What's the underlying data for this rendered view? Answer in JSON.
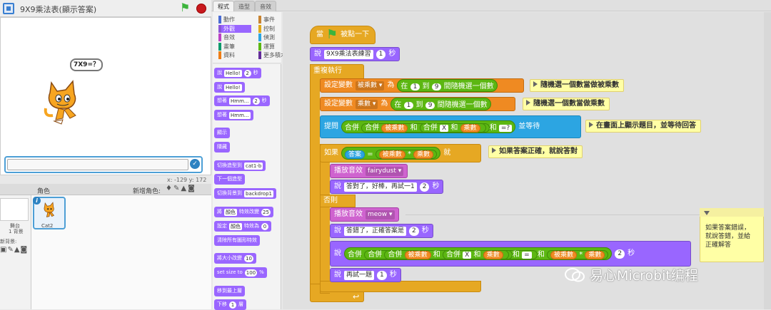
{
  "window": {
    "title": "9X9乘法表(顯示答案)",
    "app_icon_label": "v456"
  },
  "stage": {
    "bubble": "7X9=？",
    "coords": "x: -129  y: 172"
  },
  "sprites": {
    "header_label": "角色",
    "new_sprite_label": "新增角色:",
    "stage_name": "舞台",
    "stage_count": "1 背景",
    "new_backdrop_label": "新背景:",
    "sprite_name": "Cat2"
  },
  "tabs": [
    "程式",
    "造型",
    "音效"
  ],
  "categories": [
    {
      "label": "動作",
      "color": "#4a6cd4"
    },
    {
      "label": "事件",
      "color": "#c88330"
    },
    {
      "label": "外觀",
      "color": "#8a55d7"
    },
    {
      "label": "控制",
      "color": "#e1a91a"
    },
    {
      "label": "音效",
      "color": "#bb42c3"
    },
    {
      "label": "偵測",
      "color": "#2ca5e2"
    },
    {
      "label": "畫筆",
      "color": "#0e9a6c"
    },
    {
      "label": "運算",
      "color": "#5cb712"
    },
    {
      "label": "資料",
      "color": "#ee7d16"
    },
    {
      "label": "更多積木",
      "color": "#632d99"
    }
  ],
  "palette": [
    {
      "text": "說",
      "field": "Hello!",
      "num": "2",
      "suffix": "秒"
    },
    {
      "text": "說",
      "field": "Hello!"
    },
    {
      "text": "想著",
      "field": "Hmm...",
      "num": "2",
      "suffix": "秒"
    },
    {
      "text": "想著",
      "field": "Hmm..."
    },
    {
      "text": "顯示"
    },
    {
      "text": "隱藏"
    },
    {
      "text": "切換造型到",
      "field": "cat1-b"
    },
    {
      "text": "下一個造型"
    },
    {
      "text": "切換背景到",
      "field": "backdrop1"
    },
    {
      "text": "將",
      "field": "顏色",
      "text2": "特效改變",
      "num": "25"
    },
    {
      "text": "設定",
      "field": "顏色",
      "text2": "特效為",
      "num": "0"
    },
    {
      "text": "清除所有圖形特效"
    },
    {
      "text": "將大小改變",
      "num": "10"
    },
    {
      "text": "set size to",
      "num": "100",
      "suffix": "%"
    },
    {
      "text": "移到最上層"
    },
    {
      "text": "下移",
      "num": "1",
      "suffix": "層"
    }
  ],
  "script": {
    "hat": {
      "pre": "當",
      "post": "被點一下"
    },
    "say_title": {
      "label": "說",
      "text": "9X9乘法表練習",
      "secs": "1",
      "unit": "秒"
    },
    "forever": "重複執行",
    "set1": {
      "label": "設定變數",
      "var": "被乘數",
      "to": "為",
      "op_a": "在",
      "from": "1",
      "op_b": "到",
      "to_n": "9",
      "op_c": "間隨機選一個數"
    },
    "set2": {
      "label": "設定變數",
      "var": "乘數",
      "to": "為",
      "op_a": "在",
      "from": "1",
      "op_b": "到",
      "to_n": "9",
      "op_c": "間隨機選一個數"
    },
    "ask": {
      "label": "提問",
      "join": "合併",
      "var1": "被乘數",
      "and": "和",
      "times": "X",
      "var2": "乘數",
      "q": "=?",
      "wait": "並等待"
    },
    "if": {
      "label": "如果",
      "answer": "答案",
      "eq": "=",
      "var1": "被乘數",
      "mul": "*",
      "var2": "乘數",
      "then": "就"
    },
    "play1": {
      "label": "播放音效",
      "sound": "fairydust"
    },
    "say_right": {
      "label": "說",
      "text": "答對了，好棒，再試一1",
      "secs": "2",
      "unit": "秒"
    },
    "else": "否則",
    "play2": {
      "label": "播放音效",
      "sound": "meow"
    },
    "say_wrong": {
      "label": "說",
      "text": "答錯了，正確答案是",
      "secs": "2",
      "unit": "秒"
    },
    "say_join": {
      "label": "說",
      "join": "合併",
      "var1": "被乘數",
      "and": "和",
      "times": "X",
      "var2": "乘數",
      "eq": "=",
      "mul": "*",
      "secs": "2",
      "unit": "秒"
    },
    "say_again": {
      "label": "說",
      "text": "再試一題",
      "secs": "1",
      "unit": "秒"
    }
  },
  "comments": {
    "c1": "隨機選一個數當做被乘數",
    "c2": "隨機選一個數當做乘數",
    "c3": "在畫面上顯示題目，並等待回答",
    "c4": "如果答案正確，就說答對",
    "big": "如果答案錯誤，\n就說答錯，並給\n正確解答"
  },
  "watermark": "易心Microbit编程"
}
